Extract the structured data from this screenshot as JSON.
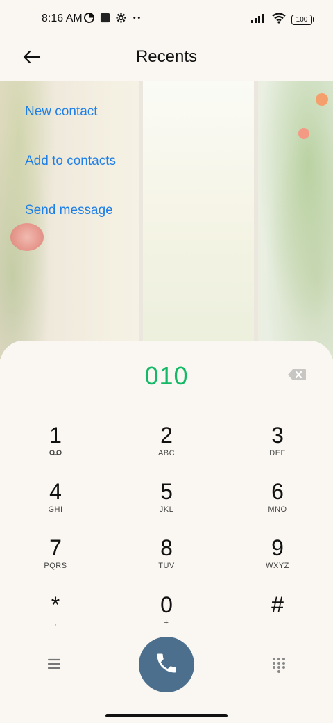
{
  "status_bar": {
    "time": "8:16 AM",
    "left_icons": [
      "data-saver-icon",
      "square-app-icon",
      "settings-gear-icon",
      "more-dots-icon"
    ],
    "right_icons": [
      "signal-icon",
      "wifi-icon",
      "battery-icon"
    ],
    "battery": "100"
  },
  "header": {
    "title": "Recents",
    "back_icon": "back-arrow-icon"
  },
  "menu": {
    "new_contact": "New contact",
    "add_to_contacts": "Add to contacts",
    "send_message": "Send message"
  },
  "dialer": {
    "number": "010",
    "backspace_icon": "backspace-icon",
    "keys": [
      {
        "digit": "1",
        "letters": "voicemail-icon"
      },
      {
        "digit": "2",
        "letters": "ABC"
      },
      {
        "digit": "3",
        "letters": "DEF"
      },
      {
        "digit": "4",
        "letters": "GHI"
      },
      {
        "digit": "5",
        "letters": "JKL"
      },
      {
        "digit": "6",
        "letters": "MNO"
      },
      {
        "digit": "7",
        "letters": "PQRS"
      },
      {
        "digit": "8",
        "letters": "TUV"
      },
      {
        "digit": "9",
        "letters": "WXYZ"
      },
      {
        "digit": "*",
        "letters": ","
      },
      {
        "digit": "0",
        "letters": "+"
      },
      {
        "digit": "#",
        "letters": ""
      }
    ],
    "bottom": {
      "menu_icon": "hamburger-menu-icon",
      "call_icon": "phone-icon",
      "dialpad_icon": "dialpad-icon"
    },
    "colors": {
      "number": "#14b866",
      "call_button": "#4c6f8e",
      "link": "#1f7fe6"
    }
  }
}
